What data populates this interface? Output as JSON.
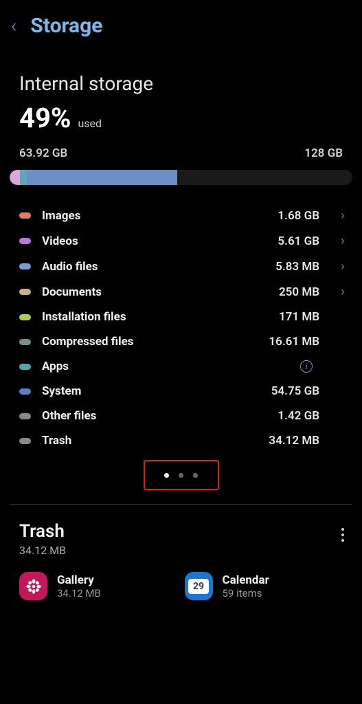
{
  "header": {
    "title": "Storage"
  },
  "internal": {
    "title": "Internal storage",
    "percent": "49%",
    "usedLabel": "used",
    "usedAmount": "63.92 GB",
    "totalAmount": "128 GB"
  },
  "categories": [
    {
      "name": "Images",
      "size": "1.68 GB",
      "color": "c-images",
      "nav": true
    },
    {
      "name": "Videos",
      "size": "5.61 GB",
      "color": "c-videos",
      "nav": true
    },
    {
      "name": "Audio files",
      "size": "5.83 MB",
      "color": "c-audio",
      "nav": true
    },
    {
      "name": "Documents",
      "size": "250 MB",
      "color": "c-docs",
      "nav": true
    },
    {
      "name": "Installation files",
      "size": "171 MB",
      "color": "c-inst",
      "nav": false
    },
    {
      "name": "Compressed files",
      "size": "16.61 MB",
      "color": "c-comp",
      "nav": false
    },
    {
      "name": "Apps",
      "size": "",
      "color": "c-apps",
      "info": true
    },
    {
      "name": "System",
      "size": "54.75 GB",
      "color": "c-sys",
      "nav": false
    },
    {
      "name": "Other files",
      "size": "1.42 GB",
      "color": "c-other",
      "nav": false
    },
    {
      "name": "Trash",
      "size": "34.12 MB",
      "color": "c-trash",
      "nav": false
    }
  ],
  "trash": {
    "title": "Trash",
    "size": "34.12 MB"
  },
  "apps": {
    "gallery": {
      "name": "Gallery",
      "sub": "34.12 MB"
    },
    "calendar": {
      "name": "Calendar",
      "sub": "59 items",
      "date": "29"
    }
  }
}
